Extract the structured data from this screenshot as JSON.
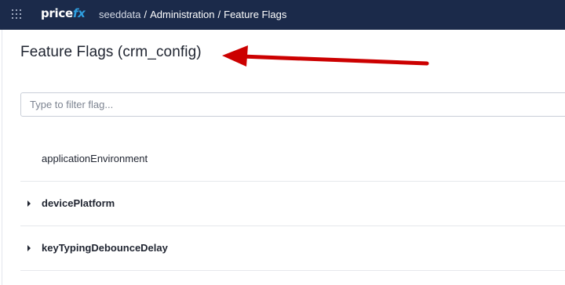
{
  "header": {
    "apps_icon": "apps-grid-icon",
    "logo": {
      "text_main": "price",
      "text_accent": "fx",
      "accent_color": "#2f9fe0"
    },
    "breadcrumb": [
      "seeddata",
      "Administration",
      "Feature Flags"
    ],
    "separator": "/",
    "background_color": "#1b2a4a"
  },
  "page": {
    "title": "Feature Flags (crm_config)"
  },
  "filter": {
    "placeholder": "Type to filter flag...",
    "value": ""
  },
  "flags": [
    {
      "name": "applicationEnvironment",
      "expandable": false
    },
    {
      "name": "devicePlatform",
      "expandable": true
    },
    {
      "name": "keyTypingDebounceDelay",
      "expandable": true
    }
  ],
  "annotation": {
    "type": "arrow",
    "color": "#cc0000",
    "points_to": "page-title"
  }
}
